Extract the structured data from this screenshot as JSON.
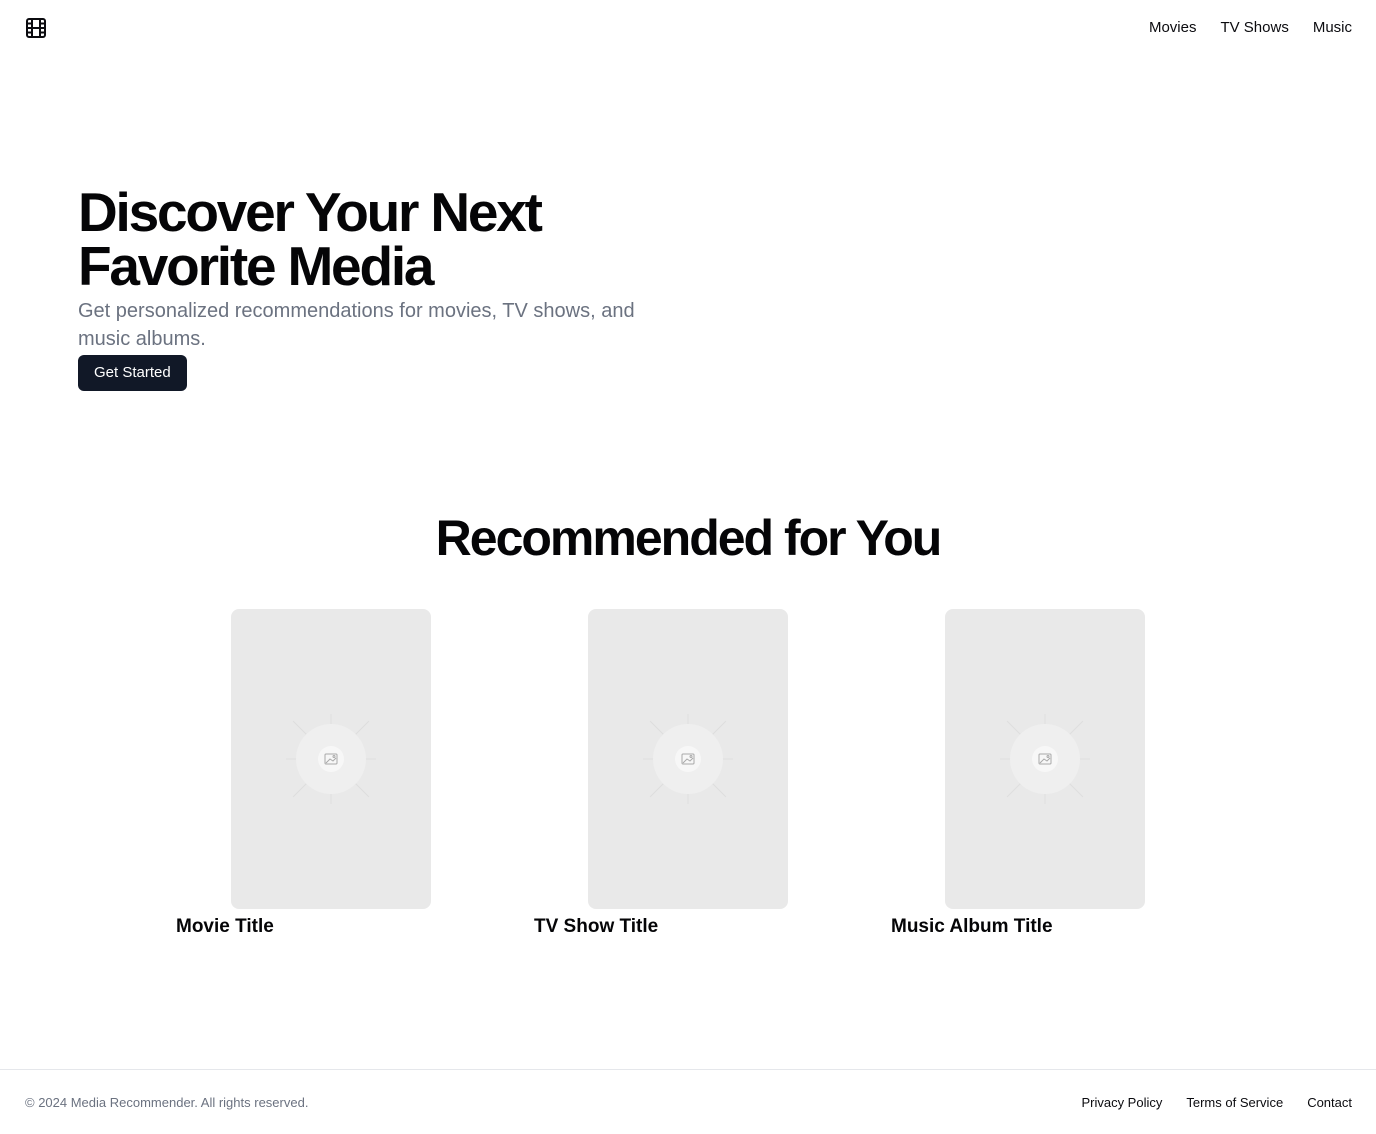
{
  "header": {
    "logo_icon": "film-icon",
    "nav": [
      {
        "label": "Movies"
      },
      {
        "label": "TV Shows"
      },
      {
        "label": "Music"
      }
    ]
  },
  "hero": {
    "title_line1": "Discover Your Next",
    "title_line2": "Favorite Media",
    "subtitle": "Get personalized recommendations for movies, TV shows, and music albums.",
    "cta_label": "Get Started"
  },
  "recommended": {
    "heading": "Recommended for You",
    "cards": [
      {
        "title": "Movie Title",
        "image_icon": "image-placeholder-icon"
      },
      {
        "title": "TV Show Title",
        "image_icon": "image-placeholder-icon"
      },
      {
        "title": "Music Album Title",
        "image_icon": "image-placeholder-icon"
      }
    ]
  },
  "footer": {
    "copyright": "© 2024 Media Recommender. All rights reserved.",
    "links": [
      {
        "label": "Privacy Policy"
      },
      {
        "label": "Terms of Service"
      },
      {
        "label": "Contact"
      }
    ]
  },
  "colors": {
    "cta_bg": "#111827",
    "muted_text": "#6b7280",
    "placeholder_bg": "#e9e9e9"
  }
}
